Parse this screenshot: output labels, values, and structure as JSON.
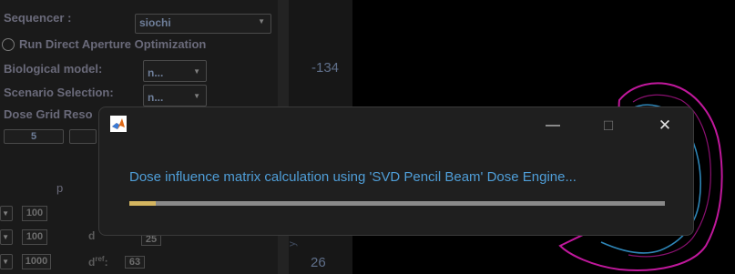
{
  "background_panel": {
    "sequencer_label": "Sequencer :",
    "sequencer_value": "siochi",
    "run_dao_label": "Run Direct Aperture Optimization",
    "bio_model_label": "Biological model:",
    "bio_model_value": "n...",
    "scenario_label": "Scenario Selection:",
    "scenario_value": "n...",
    "dose_grid_label": "Dose Grid Reso",
    "dose_grid_value": "5",
    "col_p_label": "p",
    "row1_value": "100",
    "row2_value": "100",
    "row3_value": "1000",
    "d_label": "d",
    "d_value": "25",
    "dref_label": "d",
    "dref_sup": "ref",
    "dref_value": "63",
    "top_number": "-134",
    "bottom_number": "26",
    "axis_letter": "y"
  },
  "dialog": {
    "message": "Dose influence matrix calculation using  'SVD Pencil Beam' Dose Engine...",
    "progress": 0.05,
    "minimize_glyph": "—",
    "maximize_glyph": "☐",
    "close_glyph": "✕",
    "app_icon": "matlab-icon"
  },
  "colors": {
    "accent_text": "#4f9ed8",
    "progress_fill": "#d4b560",
    "progress_track": "#8a8a8a",
    "contour_magenta": "#c0189c",
    "contour_blue": "#2e86b8"
  }
}
